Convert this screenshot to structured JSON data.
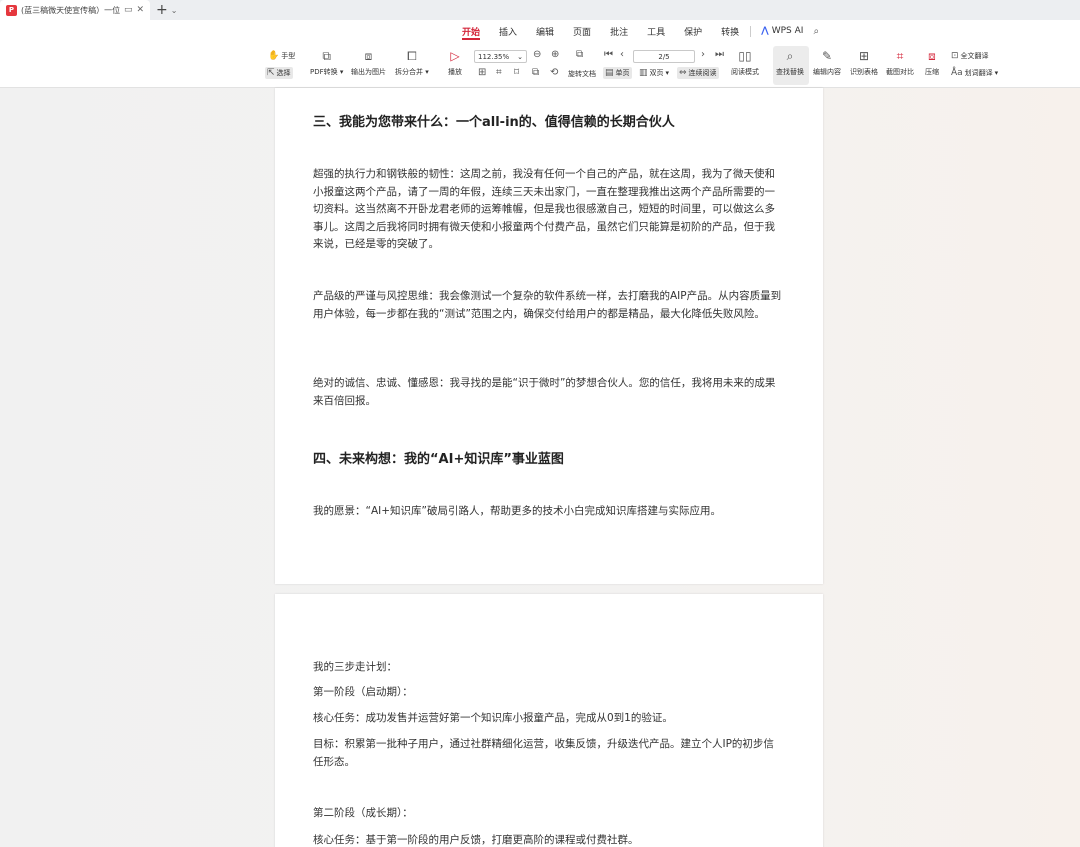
{
  "tabbar": {
    "tab_title": "(蓝三稿微天使宣传稿）一位",
    "pdf_badge": "P",
    "add_symbol": "+",
    "caret": "⌄"
  },
  "menu": {
    "items": [
      "开始",
      "插入",
      "编辑",
      "页面",
      "批注",
      "工具",
      "保护",
      "转换"
    ],
    "active_index": 0,
    "wps_ai": "WPS AI"
  },
  "toolbar": {
    "hand": "手型",
    "select": "选择",
    "pdf_convert": "PDF转换",
    "export_image": "输出为图片",
    "split_merge": "拆分合并",
    "play": "播放",
    "zoom": "112.35%",
    "page_indicator": "2/5",
    "rotate": "旋转文档",
    "single_page": "单页",
    "double_page": "双页",
    "continuous": "连续阅读",
    "reading_mode": "阅读模式",
    "find_replace": "查找替换",
    "edit_content": "编辑内容",
    "recognize_table": "识别表格",
    "screenshot_compare": "截图对比",
    "compress": "压缩",
    "full_translate": "全文翻译",
    "word_translate": "划词翻译"
  },
  "page1": {
    "heading3": "三、我能为您带来什么：一个all-in的、值得信赖的长期合伙人",
    "para1": "超强的执行力和钢铁般的韧性：这周之前，我没有任何一个自己的产品，就在这周，我为了微天使和小报童这两个产品，请了一周的年假，连续三天未出家门，一直在整理我推出这两个产品所需要的一切资料。这当然离不开卧龙君老师的运筹帷幄，但是我也很感激自己，短短的时间里，可以做这么多事儿。这周之后我将同时拥有微天使和小报童两个付费产品，虽然它们只能算是初阶的产品，但于我来说，已经是零的突破了。",
    "para2": "产品级的严谨与风控思维：我会像测试一个复杂的软件系统一样，去打磨我的AIP产品。从内容质量到用户体验，每一步都在我的“测试”范围之内，确保交付给用户的都是精品，最大化降低失败风险。",
    "para3": "绝对的诚信、忠诚、懂感恩：我寻找的是能“识于微时”的梦想合伙人。您的信任，我将用未来的成果来百倍回报。",
    "heading4": "四、未来构想：我的“AI+知识库”事业蓝图",
    "para4": "我的愿景：“AI+知识库”破局引路人，帮助更多的技术小白完成知识库搭建与实际应用。"
  },
  "page2": {
    "line1": "我的三步走计划：",
    "line2": "第一阶段（启动期）：",
    "line3": "核心任务：成功发售并运营好第一个知识库小报童产品，完成从0到1的验证。",
    "line4": "目标：积累第一批种子用户，通过社群精细化运营，收集反馈，升级迭代产品。建立个人IP的初步信任形态。",
    "line5": "第二阶段（成长期）：",
    "line6": "核心任务：基于第一阶段的用户反馈，打磨更高阶的课程或付费社群。"
  }
}
